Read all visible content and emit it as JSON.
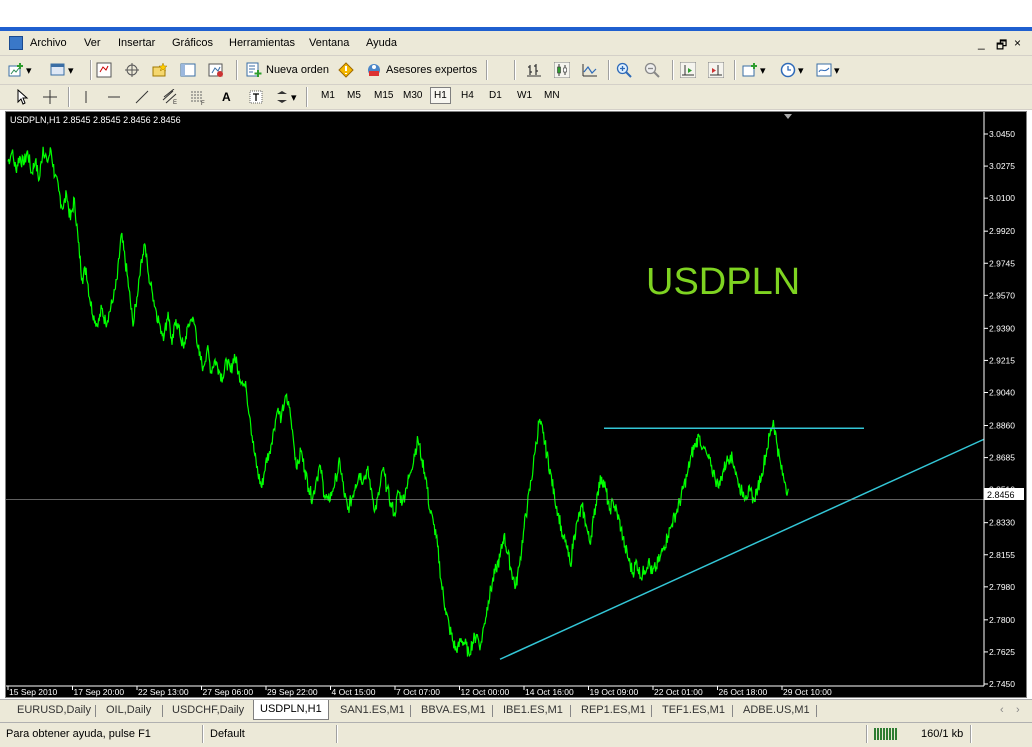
{
  "menu": {
    "items": [
      "Archivo",
      "Ver",
      "Insertar",
      "Gráficos",
      "Herramientas",
      "Ventana",
      "Ayuda"
    ],
    "window_controls": [
      "_",
      "🗗",
      "×"
    ]
  },
  "toolbar": {
    "new_order_label": "Nueva orden",
    "experts_label": "Asesores expertos",
    "text_tool_label": "A"
  },
  "timeframes": {
    "items": [
      "M1",
      "M5",
      "M15",
      "M30",
      "H1",
      "H4",
      "D1",
      "W1",
      "MN"
    ],
    "selected": "H1"
  },
  "chart": {
    "info": "USDPLN,H1  2.8545 2.8545 2.8456 2.8456",
    "symbol_label": "USDPLN",
    "current_price_label": "2.8456",
    "colors": {
      "background": "#000000",
      "price": "#00ff00",
      "trendline": "#33c6d6",
      "grid": "#808080",
      "axis_text": "#ffffff",
      "label": "#7ed321"
    }
  },
  "chart_data": {
    "type": "line",
    "title": "USDPLN,H1",
    "x_tick_labels": [
      "15 Sep 2010",
      "17 Sep 20:00",
      "22 Sep 13:00",
      "27 Sep 06:00",
      "29 Sep 22:00",
      "4 Oct 15:00",
      "7 Oct 07:00",
      "12 Oct 00:00",
      "14 Oct 16:00",
      "19 Oct 09:00",
      "22 Oct 01:00",
      "26 Oct 18:00",
      "29 Oct 10:00"
    ],
    "y_tick_labels": [
      "3.0450",
      "3.0275",
      "3.0100",
      "2.9920",
      "2.9745",
      "2.9570",
      "2.9390",
      "2.9215",
      "2.9040",
      "2.8860",
      "2.8685",
      "2.8510",
      "2.8330",
      "2.8155",
      "2.7980",
      "2.7800",
      "2.7625",
      "2.7450"
    ],
    "ylim": [
      2.745,
      3.045
    ],
    "x": [
      0,
      2,
      4,
      6,
      8,
      10,
      12,
      14,
      16,
      18,
      20,
      22,
      24,
      26,
      28,
      30,
      32,
      34,
      36,
      38,
      40,
      42,
      44,
      46,
      48,
      50,
      52,
      54,
      56,
      58,
      60,
      62,
      64,
      66,
      68,
      70,
      72,
      74,
      76,
      78,
      80,
      82,
      84,
      86,
      88,
      90,
      92,
      94,
      96,
      98,
      100,
      102,
      104,
      106,
      108,
      110,
      112,
      114,
      116,
      118,
      120,
      122,
      124,
      126,
      128,
      130,
      132,
      134,
      136,
      138,
      140,
      142,
      144,
      146,
      148,
      150,
      152,
      154,
      156,
      158,
      160,
      162,
      164,
      166,
      168,
      170,
      172,
      174,
      176,
      178,
      180,
      182,
      184,
      186,
      188,
      190,
      192,
      194,
      196,
      198,
      200,
      202,
      204,
      206,
      208,
      210,
      212,
      214,
      216,
      218,
      220,
      222,
      224,
      226,
      228,
      230,
      232,
      234,
      236,
      238,
      240,
      242,
      244,
      246,
      248,
      250,
      252,
      254,
      256,
      258,
      260,
      262,
      264,
      266,
      268,
      270,
      272,
      274,
      276,
      278,
      280,
      282,
      284,
      286,
      288,
      290,
      292,
      294,
      296,
      298,
      300,
      302,
      304,
      306,
      308,
      310,
      312,
      314,
      316,
      318,
      320,
      322,
      324,
      326,
      328,
      330,
      332,
      334,
      336,
      338,
      340,
      342,
      344,
      346,
      348,
      350,
      352,
      354,
      356,
      358,
      360,
      362,
      364,
      366,
      368,
      370,
      372,
      374,
      376,
      378,
      380,
      382,
      384,
      386,
      388,
      390,
      392,
      394,
      396,
      398,
      400
    ],
    "series": [
      {
        "values": [
          3.03,
          3.035,
          3.026,
          3.033,
          3.028,
          3.036,
          3.024,
          3.03,
          3.02,
          3.038,
          3.03,
          3.036,
          3.022,
          3.014,
          3.004,
          3.012,
          2.998,
          3.01,
          2.986,
          2.966,
          2.972,
          2.954,
          2.946,
          2.94,
          2.95,
          2.942,
          2.948,
          2.955,
          2.966,
          2.99,
          2.976,
          2.96,
          2.94,
          2.956,
          2.975,
          2.985,
          2.968,
          2.958,
          2.948,
          2.94,
          2.935,
          2.948,
          2.93,
          2.944,
          2.936,
          2.928,
          2.94,
          2.944,
          2.94,
          2.924,
          2.918,
          2.928,
          2.916,
          2.922,
          2.916,
          2.912,
          2.921,
          2.915,
          2.925,
          2.915,
          2.91,
          2.906,
          2.89,
          2.872,
          2.86,
          2.852,
          2.866,
          2.872,
          2.884,
          2.894,
          2.89,
          2.902,
          2.896,
          2.88,
          2.862,
          2.872,
          2.862,
          2.852,
          2.846,
          2.857,
          2.864,
          2.848,
          2.845,
          2.85,
          2.858,
          2.866,
          2.85,
          2.84,
          2.846,
          2.854,
          2.86,
          2.856,
          2.862,
          2.852,
          2.84,
          2.848,
          2.862,
          2.852,
          2.844,
          2.838,
          2.85,
          2.844,
          2.852,
          2.86,
          2.87,
          2.878,
          2.868,
          2.858,
          2.84,
          2.832,
          2.82,
          2.8,
          2.786,
          2.776,
          2.768,
          2.762,
          2.77,
          2.767,
          2.762,
          2.768,
          2.772,
          2.766,
          2.778,
          2.79,
          2.8,
          2.808,
          2.814,
          2.826,
          2.816,
          2.806,
          2.798,
          2.81,
          2.828,
          2.842,
          2.856,
          2.872,
          2.888,
          2.882,
          2.87,
          2.86,
          2.846,
          2.838,
          2.826,
          2.82,
          2.81,
          2.826,
          2.834,
          2.842,
          2.832,
          2.822,
          2.836,
          2.85,
          2.858,
          2.852,
          2.84,
          2.844,
          2.838,
          2.83,
          2.82,
          2.812,
          2.806,
          2.812,
          2.803,
          2.807,
          2.812,
          2.805,
          2.809,
          2.814,
          2.82,
          2.826,
          2.832,
          2.838,
          2.844,
          2.852,
          2.86,
          2.87,
          2.876,
          2.88,
          2.874,
          2.87,
          2.864,
          2.858,
          2.852,
          2.86,
          2.866,
          2.87,
          2.864,
          2.854,
          2.85,
          2.848,
          2.85,
          2.846,
          2.852,
          2.86,
          2.87,
          2.88,
          2.889,
          2.875,
          2.862,
          2.855,
          2.848,
          2.846,
          2.85,
          2.8456
        ]
      }
    ],
    "horizontal_line": 2.8845,
    "rising_trendline": [
      [
        2.7585
      ],
      [
        2.8785
      ]
    ]
  },
  "tabs": {
    "items": [
      "EURUSD,Daily",
      "OIL,Daily",
      "USDCHF,Daily",
      "USDPLN,H1",
      "SAN1.ES,M1",
      "BBVA.ES,M1",
      "IBE1.ES,M1",
      "REP1.ES,M1",
      "TEF1.ES,M1",
      "ADBE.US,M1"
    ],
    "active": "USDPLN,H1",
    "scroll": [
      "‹",
      "›"
    ]
  },
  "status": {
    "help": "Para obtener ayuda, pulse F1",
    "profile": "Default",
    "traffic": "160/1 kb"
  }
}
